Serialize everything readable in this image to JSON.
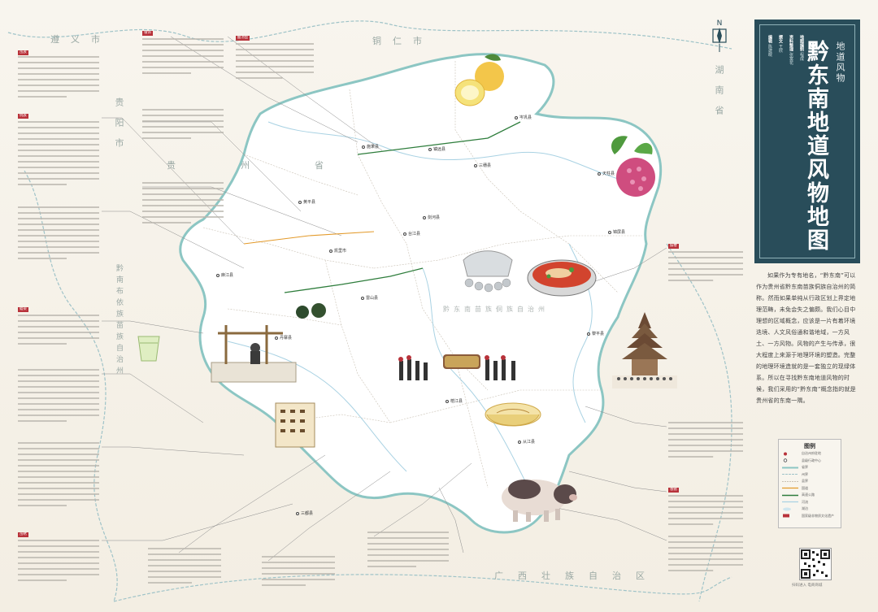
{
  "title": {
    "main": "黔东南地道风物地图",
    "sub": "地道风物",
    "credits": [
      {
        "role": "编辑",
        "name": "陈建皖"
      },
      {
        "role": "撰文",
        "name": "王欣"
      },
      {
        "role": "资料整理",
        "name": "张富花"
      },
      {
        "role": "地图编制",
        "name": "程成"
      },
      {
        "role": "插画",
        "name": "王千雁"
      },
      {
        "role": "设计",
        "name": "陈莺"
      },
      {
        "role": "审校",
        "name": "赵吉"
      }
    ]
  },
  "compass": {
    "letter": "N"
  },
  "regions": [
    {
      "text": "湖南省"
    },
    {
      "text": "广西壮族自治区"
    },
    {
      "text": "铜仁市"
    },
    {
      "text": "遵义市"
    },
    {
      "text": "贵阳市"
    },
    {
      "text": "贵州省"
    },
    {
      "text": "黔南布依族苗族自治州"
    },
    {
      "text": "黔东南苗族侗族自治州"
    }
  ],
  "counties": [
    {
      "name": "岑巩县"
    },
    {
      "name": "三穗县"
    },
    {
      "name": "天柱县"
    },
    {
      "name": "锦屏县"
    },
    {
      "name": "剑河县"
    },
    {
      "name": "镇远县"
    },
    {
      "name": "施秉县"
    },
    {
      "name": "黄平县"
    },
    {
      "name": "台江县"
    },
    {
      "name": "凯里市"
    },
    {
      "name": "麻江县"
    },
    {
      "name": "丹寨县"
    },
    {
      "name": "雷山县"
    },
    {
      "name": "黎平县"
    },
    {
      "name": "榕江县"
    },
    {
      "name": "从江县"
    },
    {
      "name": "三都县"
    }
  ],
  "notes": [
    {
      "tag": "苗族"
    },
    {
      "tag": "侗族"
    },
    {
      "tag": "银饰"
    },
    {
      "tag": "酸汤鱼"
    },
    {
      "tag": "蜡染"
    },
    {
      "tag": "香猪"
    },
    {
      "tag": "鼓楼"
    },
    {
      "tag": "苗绣"
    }
  ],
  "intro_text": "如果作为专有地名，“黔东南”可以作为贵州省黔东南苗族侗族自治州的简称。然而如果单纯从行政区划上界定地理范畴，未免会失之偏颇。我们心目中理想的区域概念，应该是一片有着环境迭境、人文风俗通和谐地域，一方风土、一方风物。风物的产生与传承，很大程度上来源于地理环境的塑造。完整的地理环境造就的是一套独立的现绿体系。所以在寻找黔东南地道风物的时候，我们采用的“黔东南”概念指的就是贵州省的东南一隅。",
  "legend": {
    "title": "图例",
    "items": [
      "自治州府驻地",
      "县级行政中心",
      "省界",
      "州界",
      "县界",
      "国道",
      "高速公路",
      "河流",
      "湖泊",
      "国家级非物质文化遗产"
    ]
  },
  "qr_caption": "扫码进入 电商商城"
}
